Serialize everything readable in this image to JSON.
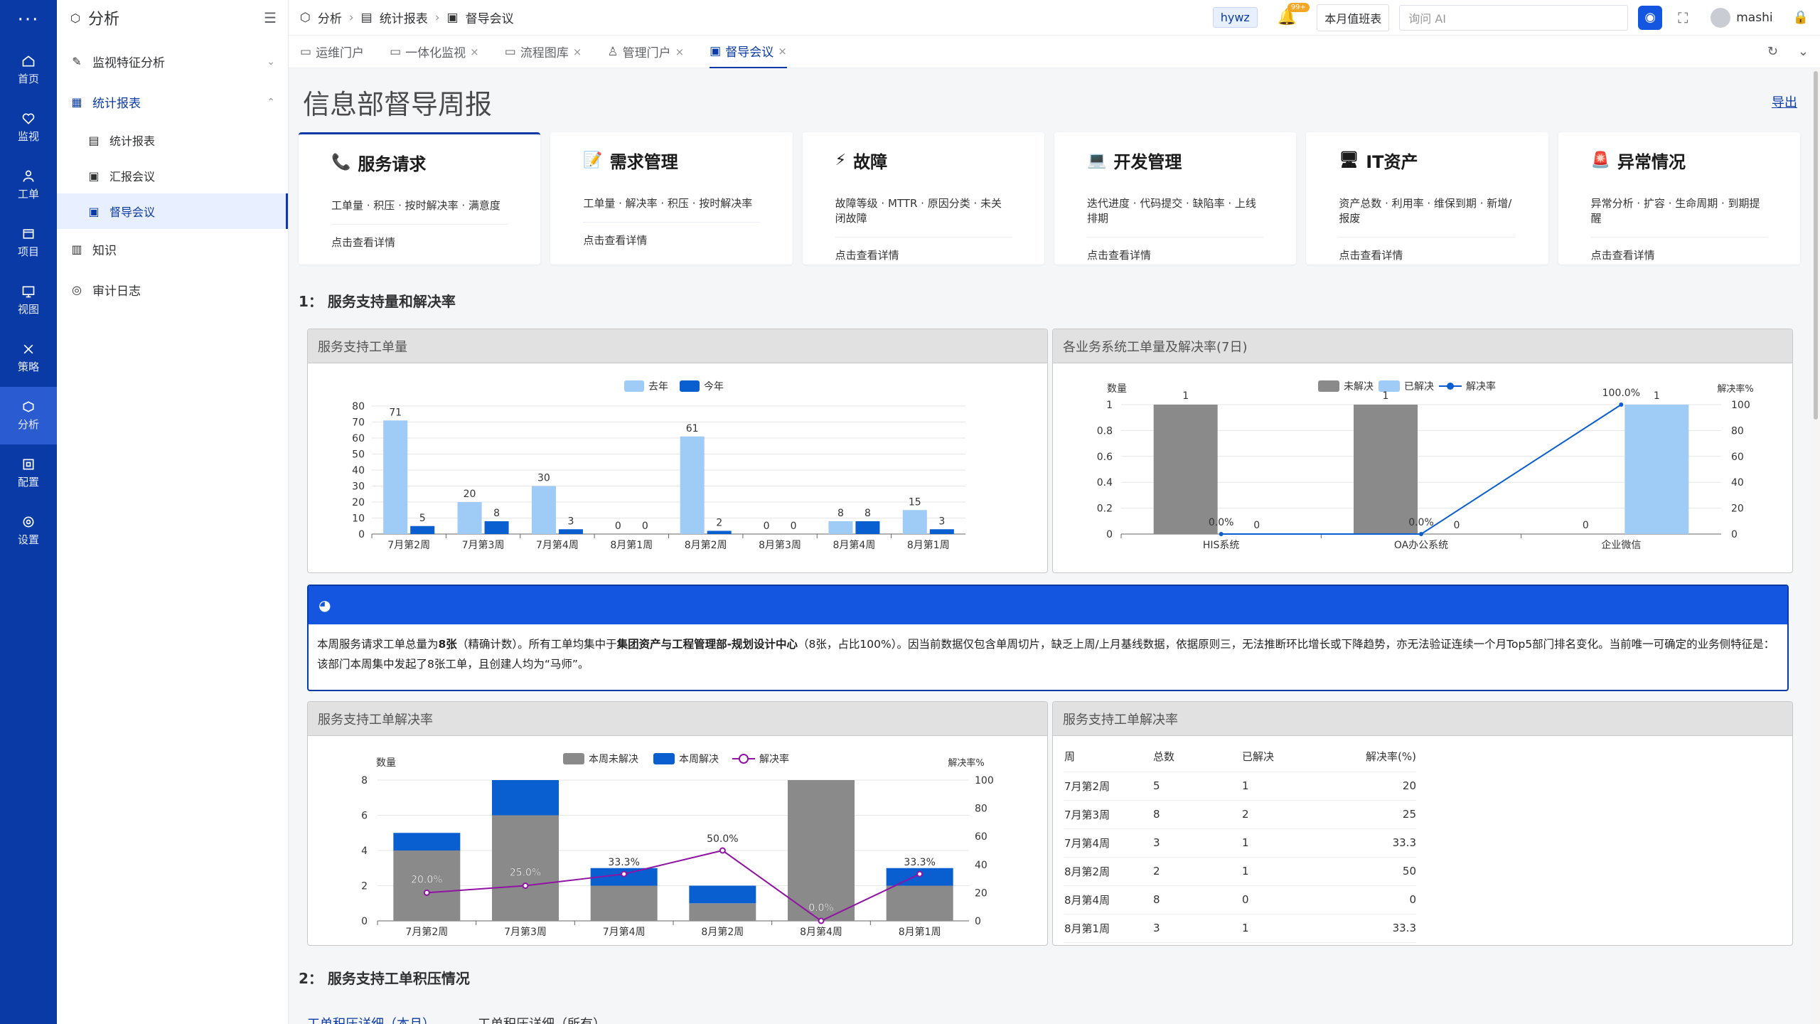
{
  "app": {
    "menu_dots": "···",
    "title": "分析"
  },
  "rail": [
    {
      "label": "首页",
      "icon": "home-icon"
    },
    {
      "label": "监视",
      "icon": "monitor-icon"
    },
    {
      "label": "工单",
      "icon": "ticket-icon"
    },
    {
      "label": "项目",
      "icon": "project-icon"
    },
    {
      "label": "视图",
      "icon": "view-icon"
    },
    {
      "label": "策略",
      "icon": "policy-icon"
    },
    {
      "label": "分析",
      "icon": "analysis-icon"
    },
    {
      "label": "配置",
      "icon": "config-icon"
    },
    {
      "label": "设置",
      "icon": "settings-icon"
    }
  ],
  "sidebar": {
    "items": [
      {
        "label": "监视特征分析"
      },
      {
        "label": "统计报表"
      },
      {
        "label": "统计报表"
      },
      {
        "label": "汇报会议"
      },
      {
        "label": "督导会议"
      },
      {
        "label": "知识"
      },
      {
        "label": "审计日志"
      }
    ]
  },
  "breadcrumb": [
    "分析",
    "统计报表",
    "督导会议"
  ],
  "header": {
    "tag": "hywz",
    "badge": "99+",
    "duty": "本月值班表",
    "ai_placeholder": "询问 AI",
    "user": "mashi"
  },
  "tabs": [
    {
      "label": "运维门户"
    },
    {
      "label": "一体化监视",
      "x": "×"
    },
    {
      "label": "流程图库",
      "x": "×"
    },
    {
      "label": "管理门户",
      "x": "×"
    },
    {
      "label": "督导会议",
      "x": "×"
    }
  ],
  "page": {
    "title": "信息部督导周报",
    "export": "导出"
  },
  "cards": [
    {
      "title": "服务请求",
      "icon": "phone-icon",
      "glyph": "📞",
      "metrics": "工单量 · 积压 · 按时解决率 · 满意度",
      "link": "点击查看详情"
    },
    {
      "title": "需求管理",
      "icon": "memo-icon",
      "glyph": "📝",
      "metrics": "工单量 · 解决率 · 积压 · 按时解决率",
      "link": "点击查看详情"
    },
    {
      "title": "故障",
      "icon": "lightning-icon",
      "glyph": "⚡",
      "metrics": "故障等级 · MTTR · 原因分类 · 未关闭故障",
      "link": "点击查看详情"
    },
    {
      "title": "开发管理",
      "icon": "laptop-icon",
      "glyph": "💻",
      "metrics": "迭代进度 · 代码提交 · 缺陷率 · 上线排期",
      "link": "点击查看详情"
    },
    {
      "title": "IT资产",
      "icon": "desktop-icon",
      "glyph": "🖥",
      "metrics": "资产总数 · 利用率 · 维保到期 · 新增/报废",
      "link": "点击查看详情"
    },
    {
      "title": "异常情况",
      "icon": "alarm-icon",
      "glyph": "🚨",
      "metrics": "异常分析 · 扩容 · 生命周期 · 到期提醒",
      "link": "点击查看详情"
    }
  ],
  "sections": {
    "s1": "1： 服务支持量和解决率",
    "s2": "2： 服务支持工单积压情况"
  },
  "panels": {
    "p1": "服务支持工单量",
    "p2": "各业务系统工单量及解决率(7日)",
    "p3": "服务支持工单解决率",
    "p4": "服务支持工单解决率"
  },
  "ai": {
    "icon": "robot-icon",
    "text_a": "本周服务请求工单总量为",
    "text_b": "8张",
    "text_c": "（精确计数）。所有工单均集中于",
    "text_d": "集团资产与工程管理部-规划设计中心",
    "text_e": "（8张，占比100%）。因当前数据仅包含单周切片，缺乏上周/上月基线数据，依据原则三，无法推断环比增长或下降趋势，亦无法验证连续一个月Top5部门排名变化。当前唯一可确定的业务侧特征是：该部门本周集中发起了8张工单，且创建人均为“马师”。"
  },
  "table": {
    "headers": [
      "周",
      "总数",
      "已解决",
      "解决率(%)"
    ],
    "rows": [
      [
        "7月第2周",
        "5",
        "1",
        "20"
      ],
      [
        "7月第3周",
        "8",
        "2",
        "25"
      ],
      [
        "7月第4周",
        "3",
        "1",
        "33.3"
      ],
      [
        "8月第2周",
        "2",
        "1",
        "50"
      ],
      [
        "8月第4周",
        "8",
        "0",
        "0"
      ],
      [
        "8月第1周",
        "3",
        "1",
        "33.3"
      ]
    ]
  },
  "bottom_tabs": [
    "工单积压详细（本月）",
    "工单积压详细（所有）"
  ],
  "colors": {
    "brand": "#0a3aa6",
    "last_year": "#9fcbf7",
    "this_year": "#0a5fd0",
    "unresolved": "#8a8a8a",
    "resolved_light": "#9fcbf7",
    "line_blue": "#0a5fd0",
    "line_purple": "#9013a3"
  },
  "chart_data": [
    {
      "type": "bar",
      "legend": [
        "去年",
        "今年"
      ],
      "categories": [
        "7月第2周",
        "7月第3周",
        "7月第4周",
        "8月第1周",
        "8月第2周",
        "8月第3周",
        "8月第4周",
        "8月第1周"
      ],
      "series": [
        {
          "name": "去年",
          "values": [
            71,
            20,
            30,
            0,
            61,
            0,
            8,
            15
          ]
        },
        {
          "name": "今年",
          "values": [
            5,
            8,
            3,
            0,
            2,
            0,
            8,
            3
          ]
        }
      ],
      "yticks": [
        0,
        10,
        20,
        30,
        40,
        50,
        60,
        70,
        80
      ],
      "ylim": [
        0,
        80
      ]
    },
    {
      "type": "bar",
      "legend": [
        "未解决",
        "已解决",
        "解决率"
      ],
      "categories": [
        "HIS系统",
        "OA办公系统",
        "企业微信"
      ],
      "series": [
        {
          "name": "未解决",
          "values": [
            1,
            1,
            0
          ]
        },
        {
          "name": "已解决",
          "values": [
            0,
            0,
            1
          ]
        },
        {
          "name": "解决率",
          "values": [
            0,
            0,
            100
          ],
          "labels": [
            "0.0%",
            "0.0%",
            "100.0%"
          ]
        }
      ],
      "ylabel": "数量",
      "y2label": "解决率%",
      "yticks": [
        "0",
        "0.2",
        "0.4",
        "0.6",
        "0.8",
        "1"
      ],
      "y2ticks": [
        "0",
        "20",
        "40",
        "60",
        "80",
        "100"
      ],
      "ylim": [
        0,
        1
      ],
      "y2lim": [
        0,
        100
      ]
    },
    {
      "type": "bar",
      "legend": [
        "本周未解决",
        "本周解决",
        "解决率"
      ],
      "categories": [
        "7月第2周",
        "7月第3周",
        "7月第4周",
        "8月第2周",
        "8月第4周",
        "8月第1周"
      ],
      "series": [
        {
          "name": "本周未解决",
          "values": [
            4,
            6,
            2,
            1,
            8,
            2
          ]
        },
        {
          "name": "本周解决",
          "values": [
            1,
            2,
            1,
            1,
            0,
            1
          ]
        },
        {
          "name": "解决率",
          "values": [
            20,
            25,
            33.3,
            50,
            0,
            33.3
          ],
          "labels": [
            "20.0%",
            "25.0%",
            "33.3%",
            "50.0%",
            "0.0%",
            "33.3%"
          ]
        }
      ],
      "ylabel": "数量",
      "y2label": "解决率%",
      "yticks": [
        "0",
        "2",
        "4",
        "6",
        "8"
      ],
      "y2ticks": [
        "0",
        "20",
        "40",
        "60",
        "80",
        "100"
      ],
      "ylim": [
        0,
        8
      ],
      "y2lim": [
        0,
        100
      ]
    }
  ]
}
